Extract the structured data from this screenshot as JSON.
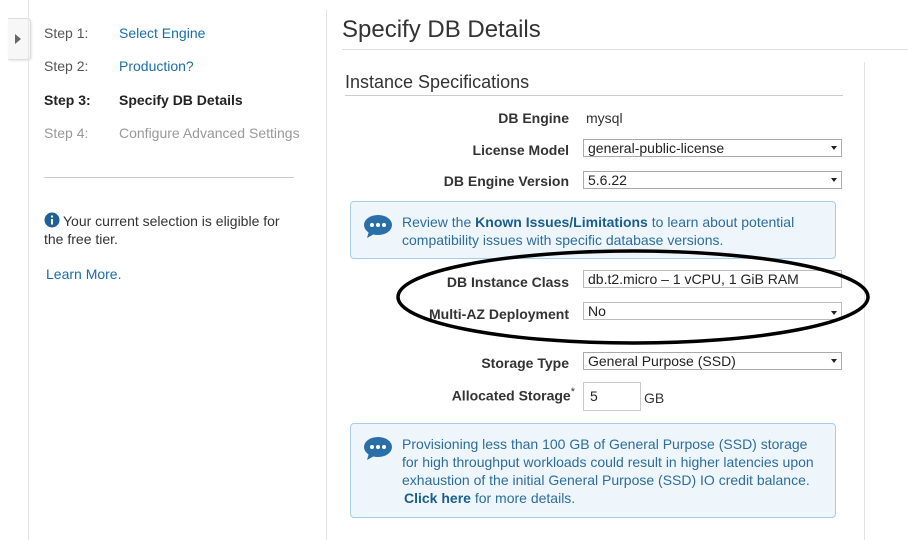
{
  "wizard": {
    "steps": [
      {
        "num": "Step 1:",
        "label": "Select Engine"
      },
      {
        "num": "Step 2:",
        "label": "Production?"
      },
      {
        "num": "Step 3:",
        "label": "Specify DB Details"
      },
      {
        "num": "Step 4:",
        "label": "Configure Advanced Settings"
      }
    ],
    "info_text": "Your current selection is eligible for the free tier.",
    "learn_more": "Learn More",
    "learn_more_dot": "."
  },
  "page": {
    "title": "Specify DB Details",
    "section_title": "Instance Specifications"
  },
  "fields": {
    "db_engine": {
      "label": "DB Engine",
      "value": "mysql"
    },
    "license_model": {
      "label": "License Model",
      "value": "general-public-license"
    },
    "engine_version": {
      "label": "DB Engine Version",
      "value": "5.6.22"
    },
    "instance_class": {
      "label": "DB Instance Class",
      "value": "db.t2.micro – 1 vCPU, 1 GiB RAM"
    },
    "multi_az": {
      "label": "Multi-AZ Deployment",
      "value": "No"
    },
    "storage_type": {
      "label": "Storage Type",
      "value": "General Purpose (SSD)"
    },
    "allocated_storage": {
      "label": "Allocated Storage",
      "required_mark": "*",
      "value": "5",
      "unit": "GB"
    }
  },
  "notices": {
    "known_issues": {
      "pre": "Review the ",
      "link": "Known Issues/Limitations",
      "post": " to learn about potential compatibility issues with specific database versions."
    },
    "storage": {
      "text": "Provisioning less than 100 GB of General Purpose (SSD) storage for high throughput workloads could result in higher latencies upon exhaustion of the initial General Purpose (SSD) IO credit balance.",
      "link": "Click here",
      "post": " for more details."
    }
  },
  "colors": {
    "link": "#1a6ea8",
    "notice_bg": "#eef6fc",
    "notice_border": "#a9cde6",
    "icon_blue": "#2a6fa8"
  },
  "icons": [
    "chevron-right-icon",
    "info-icon",
    "speech-bubble-icon"
  ]
}
